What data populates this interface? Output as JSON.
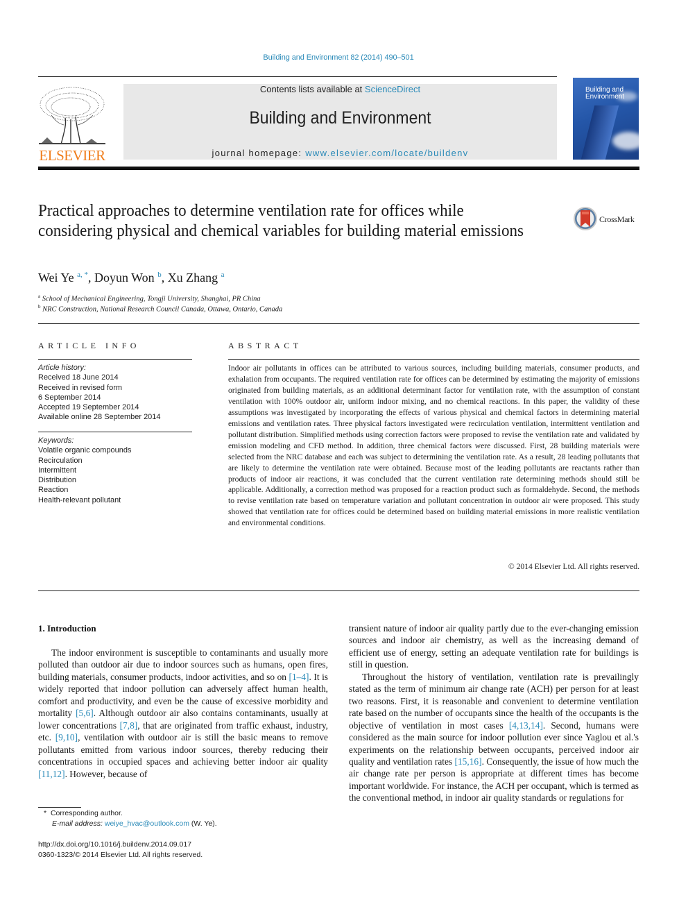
{
  "header": {
    "journal_ref": "Building and Environment 82 (2014) 490–501",
    "contents_prefix": "Contents lists available at ",
    "contents_link": "ScienceDirect",
    "journal_title": "Building and Environment",
    "homepage_prefix": "journal homepage: ",
    "homepage_link": "www.elsevier.com/locate/buildenv",
    "publisher_logo_text": "ELSEVIER",
    "cover_title_line1": "Building and",
    "cover_title_line2": "Environment",
    "colors": {
      "link": "#2a8ab8",
      "elsevier_orange": "#f07d1b",
      "banner_gray": "#e8e8e8"
    }
  },
  "article": {
    "title": "Practical approaches to determine ventilation rate for offices while considering physical and chemical variables for building material emissions",
    "crossmark_label": "CrossMark",
    "authors": [
      {
        "name": "Wei Ye",
        "sup": "a, *"
      },
      {
        "name": "Doyun Won",
        "sup": "b"
      },
      {
        "name": "Xu Zhang",
        "sup": "a"
      }
    ],
    "affiliations": [
      {
        "mark": "a",
        "text": "School of Mechanical Engineering, Tongji University, Shanghai, PR China"
      },
      {
        "mark": "b",
        "text": "NRC Construction, National Research Council Canada, Ottawa, Ontario, Canada"
      }
    ]
  },
  "article_info": {
    "heading": "ARTICLE INFO",
    "history_label": "Article history:",
    "history": [
      "Received 18 June 2014",
      "Received in revised form",
      "6 September 2014",
      "Accepted 19 September 2014",
      "Available online 28 September 2014"
    ],
    "keywords_label": "Keywords:",
    "keywords": [
      "Volatile organic compounds",
      "Recirculation",
      "Intermittent",
      "Distribution",
      "Reaction",
      "Health-relevant pollutant"
    ]
  },
  "abstract": {
    "heading": "ABSTRACT",
    "text": "Indoor air pollutants in offices can be attributed to various sources, including building materials, consumer products, and exhalation from occupants. The required ventilation rate for offices can be determined by estimating the majority of emissions originated from building materials, as an additional determinant factor for ventilation rate, with the assumption of constant ventilation with 100% outdoor air, uniform indoor mixing, and no chemical reactions. In this paper, the validity of these assumptions was investigated by incorporating the effects of various physical and chemical factors in determining material emissions and ventilation rates. Three physical factors investigated were recirculation ventilation, intermittent ventilation and pollutant distribution. Simplified methods using correction factors were proposed to revise the ventilation rate and validated by emission modeling and CFD method. In addition, three chemical factors were discussed. First, 28 building materials were selected from the NRC database and each was subject to determining the ventilation rate. As a result, 28 leading pollutants that are likely to determine the ventilation rate were obtained. Because most of the leading pollutants are reactants rather than products of indoor air reactions, it was concluded that the current ventilation rate determining methods should still be applicable. Additionally, a correction method was proposed for a reaction product such as formaldehyde. Second, the methods to revise ventilation rate based on temperature variation and pollutant concentration in outdoor air were proposed. This study showed that ventilation rate for offices could be determined based on building material emissions in more realistic ventilation and environmental conditions.",
    "copyright": "© 2014 Elsevier Ltd. All rights reserved."
  },
  "introduction": {
    "heading": "1.  Introduction",
    "left_col": {
      "segments": [
        {
          "t": "The indoor environment is susceptible to contaminants and usually more polluted than outdoor air due to indoor sources such as humans, open fires, building materials, consumer products, indoor activities, and so on "
        },
        {
          "ref": "[1–4]"
        },
        {
          "t": ". It is widely reported that indoor pollution can adversely affect human health, comfort and productivity, and even be the cause of excessive morbidity and mortality "
        },
        {
          "ref": "[5,6]"
        },
        {
          "t": ". Although outdoor air also contains contaminants, usually at lower concentrations "
        },
        {
          "ref": "[7,8]"
        },
        {
          "t": ", that are originated from traffic exhaust, industry, etc. "
        },
        {
          "ref": "[9,10]"
        },
        {
          "t": ", ventilation with outdoor air is still the basic means to remove pollutants emitted from various indoor sources, thereby reducing their concentrations in occupied spaces and achieving better indoor air quality "
        },
        {
          "ref": "[11,12]"
        },
        {
          "t": ". However, because of"
        }
      ]
    },
    "right_col": {
      "p1": "transient nature of indoor air quality partly due to the ever-changing emission sources and indoor air chemistry, as well as the increasing demand of efficient use of energy, setting an adequate ventilation rate for buildings is still in question.",
      "p2_segments": [
        {
          "t": "Throughout the history of ventilation, ventilation rate is prevailingly stated as the term of minimum air change rate (ACH) per person for at least two reasons. First, it is reasonable and convenient to determine ventilation rate based on the number of occupants since the health of the occupants is the objective of ventilation in most cases "
        },
        {
          "ref": "[4,13,14]"
        },
        {
          "t": ". Second, humans were considered as the main source for indoor pollution ever since Yaglou et al.'s experiments on the relationship between occupants, perceived indoor air quality and ventilation rates "
        },
        {
          "ref": "[15,16]"
        },
        {
          "t": ". Consequently, the issue of how much the air change rate per person is appropriate at different times has become important worldwide. For instance, the ACH per occupant, which is termed as the conventional method, in indoor air quality standards or regulations for"
        }
      ]
    }
  },
  "footnotes": {
    "corresponding_mark": "*",
    "corresponding_text": "Corresponding author.",
    "email_label": "E-mail address:",
    "email": "weiye_hvac@outlook.com",
    "email_suffix": " (W. Ye).",
    "doi": "http://dx.doi.org/10.1016/j.buildenv.2014.09.017",
    "issn_line": "0360-1323/© 2014 Elsevier Ltd. All rights reserved."
  }
}
